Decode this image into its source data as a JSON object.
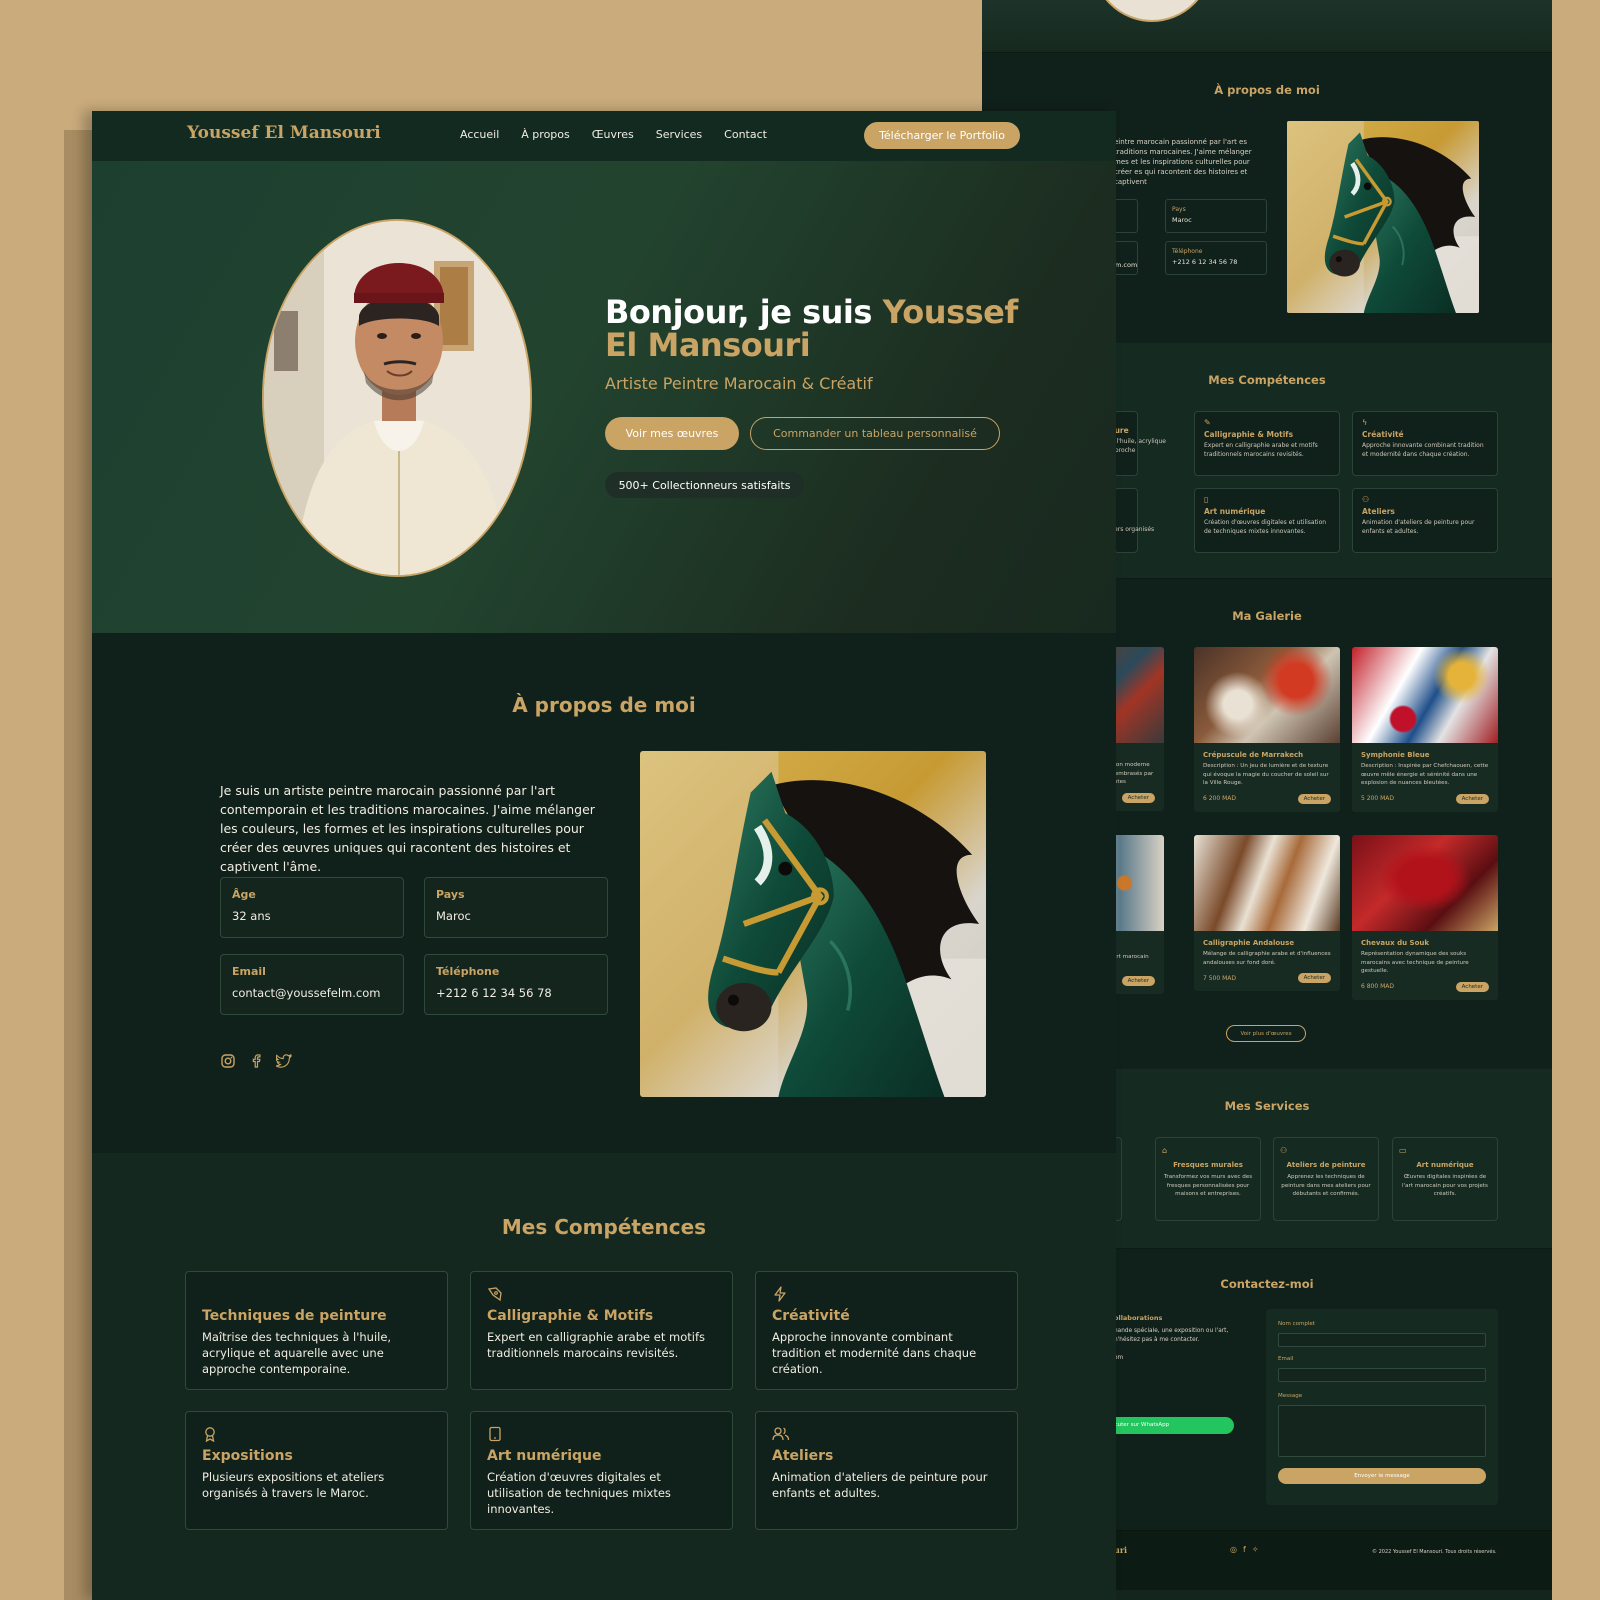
{
  "brand": "Youssef El Mansouri",
  "nav": {
    "items": [
      "Accueil",
      "À propos",
      "Œuvres",
      "Services",
      "Contact"
    ],
    "cta": "Télécharger le Portfolio"
  },
  "hero": {
    "greeting": "Bonjour, je suis",
    "name": "Youssef El Mansouri",
    "subtitle": "Artiste Peintre Marocain & Créatif",
    "primary_button": "Voir mes œuvres",
    "secondary_button": "Commander un tableau personnalisé",
    "badge": "500+ Collectionneurs satisfaits"
  },
  "about": {
    "title": "À propos de moi",
    "text": "Je suis un artiste peintre marocain passionné par l'art contemporain et les traditions marocaines. J'aime mélanger les couleurs, les formes et les inspirations culturelles pour créer des œuvres uniques qui racontent des histoires et captivent l'âme.",
    "info": [
      {
        "label": "Âge",
        "value": "32 ans"
      },
      {
        "label": "Pays",
        "value": "Maroc"
      },
      {
        "label": "Email",
        "value": "contact@youssefelm.com"
      },
      {
        "label": "Téléphone",
        "value": "+212 6 12 34 56 78"
      }
    ],
    "socials": [
      "instagram-icon",
      "facebook-icon",
      "twitter-icon"
    ]
  },
  "skills": {
    "title": "Mes Compétences",
    "items": [
      {
        "icon": "palette-icon",
        "title": "Techniques de peinture",
        "desc": "Maîtrise des techniques à l'huile, acrylique et aquarelle avec une approche contemporaine."
      },
      {
        "icon": "pen-nib-icon",
        "title": "Calligraphie & Motifs",
        "desc": "Expert en calligraphie arabe et motifs traditionnels marocains revisités."
      },
      {
        "icon": "lightning-icon",
        "title": "Créativité",
        "desc": "Approche innovante combinant tradition et modernité dans chaque création."
      },
      {
        "icon": "award-icon",
        "title": "Expositions",
        "desc": "Plusieurs expositions et ateliers organisés à travers le Maroc."
      },
      {
        "icon": "tablet-icon",
        "title": "Art numérique",
        "desc": "Création d'œuvres digitales et utilisation de techniques mixtes innovantes."
      },
      {
        "icon": "users-icon",
        "title": "Ateliers",
        "desc": "Animation d'ateliers de peinture pour enfants et adultes."
      }
    ]
  },
  "back": {
    "about_title": "À propos de moi",
    "about_text": "eintre marocain passionné par l'art es traditions marocaines. J'aime mélanger mes et les inspirations culturelles pour créer es qui racontent des histoires et captivent",
    "info": [
      {
        "label": "Pays",
        "value": "Maroc"
      },
      {
        "label": "Téléphone",
        "value": "+212 6 12 34 56 78"
      },
      {
        "label": "",
        "value": "m.com"
      }
    ],
    "skills_title": "Mes Compétences",
    "skills": [
      {
        "title": "ture",
        "desc": "à l'huile, acrylique pproche"
      },
      {
        "title": "Calligraphie & Motifs",
        "desc": "Expert en calligraphie arabe et motifs traditionnels marocains revisités."
      },
      {
        "title": "Créativité",
        "desc": "Approche innovante combinant tradition et modernité dans chaque création."
      },
      {
        "title": "",
        "desc": "ateliers organisés"
      },
      {
        "title": "Art numérique",
        "desc": "Création d'œuvres digitales et utilisation de techniques mixtes innovantes."
      },
      {
        "title": "Ateliers",
        "desc": "Animation d'ateliers de peinture pour enfants et adultes."
      }
    ],
    "gallery_title": "Ma Galerie",
    "gallery": [
      {
        "title": "",
        "desc": "ntation moderne ech embrasés par ibrantes",
        "price": "",
        "buy": "Acheter"
      },
      {
        "title": "Crépuscule de Marrakech",
        "desc": "Description : Un jeu de lumière et de texture qui évoque la magie du coucher de soleil sur la Ville Rouge.",
        "price": "6 200 MAD",
        "buy": "Acheter"
      },
      {
        "title": "Symphonie Bleue",
        "desc": "Description : Inspirée par Chefchaouen, cette œuvre mêle énergie et sérénité dans une explosion de nuances bleutées.",
        "price": "5 200 MAD",
        "buy": "Acheter"
      },
      {
        "title": "",
        "desc": "désert marocain uk",
        "price": "",
        "buy": "Acheter"
      },
      {
        "title": "Calligraphie Andalouse",
        "desc": "Mélange de calligraphie arabe et d'influences andalouses sur fond doré.",
        "price": "7 500 MAD",
        "buy": "Acheter"
      },
      {
        "title": "Chevaux du Souk",
        "desc": "Représentation dynamique des souks marocains avec technique de peinture gestuelle.",
        "price": "6 800 MAD",
        "buy": "Acheter"
      }
    ],
    "gallery_more": "Voir plus d'œuvres",
    "services_title": "Mes Services",
    "services": [
      {
        "title": "Fresques murales",
        "desc": "Transformez vos murs avec des fresques personnalisées pour maisons et entreprises."
      },
      {
        "title": "Ateliers de peinture",
        "desc": "Apprenez les techniques de peinture dans mes ateliers pour débutants et confirmés."
      },
      {
        "title": "Art numérique",
        "desc": "Œuvres digitales inspirées de l'art marocain pour vos projets créatifs."
      }
    ],
    "contact_title": "Contactez-moi",
    "contact_sub": "ollaborations",
    "contact_text": "nande spéciale, une exposition ou l'art, n'hésitez pas à me contacter.",
    "contact_mail": "om",
    "whatsapp": "Discuter sur WhatsApp",
    "form_labels": [
      "Nom complet",
      "Email",
      "Message"
    ],
    "send": "Envoyer le message",
    "footer_brand": "uri",
    "copyright": "© 2022 Youssef El Mansouri. Tous droits réservés."
  }
}
